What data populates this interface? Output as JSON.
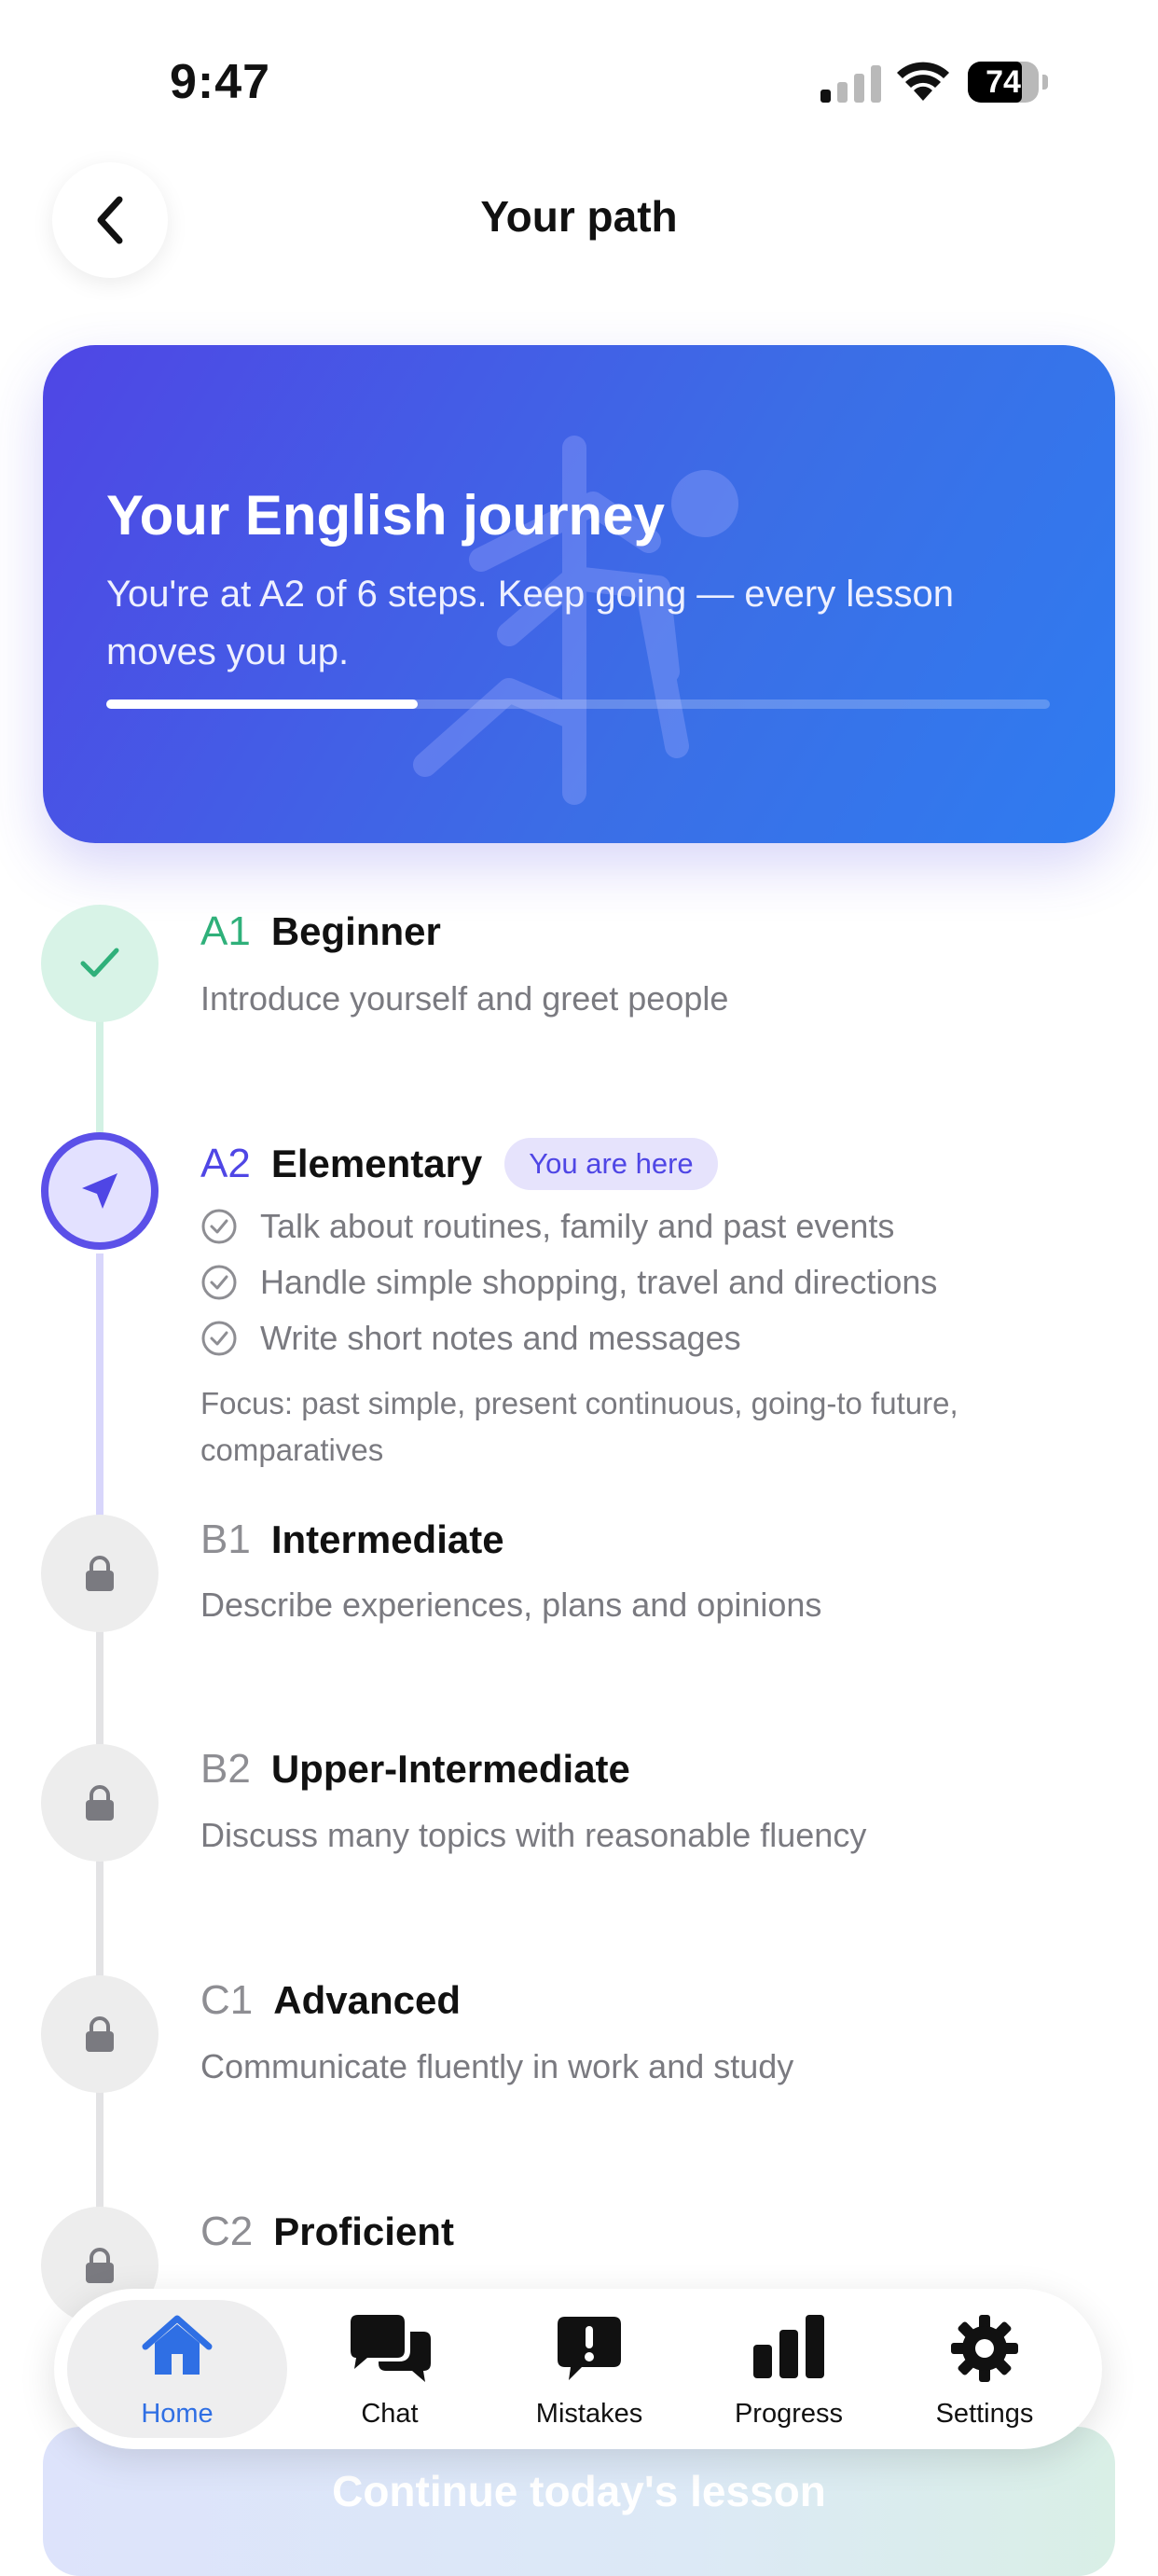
{
  "status": {
    "time": "9:47",
    "battery": "74"
  },
  "header": {
    "title": "Your path"
  },
  "hero": {
    "title": "Your English journey",
    "subtitle": "You're at A2 of 6 steps. Keep going — every lesson moves you up.",
    "progress": 0.33
  },
  "steps": [
    {
      "code": "A1",
      "level": "Beginner",
      "state": "done",
      "desc": "Introduce yourself and greet people"
    },
    {
      "code": "A2",
      "level": "Elementary",
      "state": "current",
      "badge": "You are here",
      "goals": [
        "Talk about routines, family and past events",
        "Handle simple shopping, travel and directions",
        "Write short notes and messages"
      ],
      "focus": "Focus: past simple, present continuous, going-to future, comparatives"
    },
    {
      "code": "B1",
      "level": "Intermediate",
      "state": "locked",
      "desc": "Describe experiences, plans and opinions"
    },
    {
      "code": "B2",
      "level": "Upper-Intermediate",
      "state": "locked",
      "desc": "Discuss many topics with reasonable fluency"
    },
    {
      "code": "C1",
      "level": "Advanced",
      "state": "locked",
      "desc": "Communicate fluently in work and study"
    },
    {
      "code": "C2",
      "level": "Proficient",
      "state": "locked"
    }
  ],
  "cta": {
    "label": "Continue today's lesson"
  },
  "tabs": [
    {
      "label": "Home",
      "icon": "home-icon",
      "active": true
    },
    {
      "label": "Chat",
      "icon": "chat-icon"
    },
    {
      "label": "Mistakes",
      "icon": "mistakes-icon"
    },
    {
      "label": "Progress",
      "icon": "progress-icon"
    },
    {
      "label": "Settings",
      "icon": "settings-icon"
    }
  ],
  "colors": {
    "accent": "#4f46e5",
    "done": "#2fb07a",
    "tab_active": "#2f6fe4"
  }
}
